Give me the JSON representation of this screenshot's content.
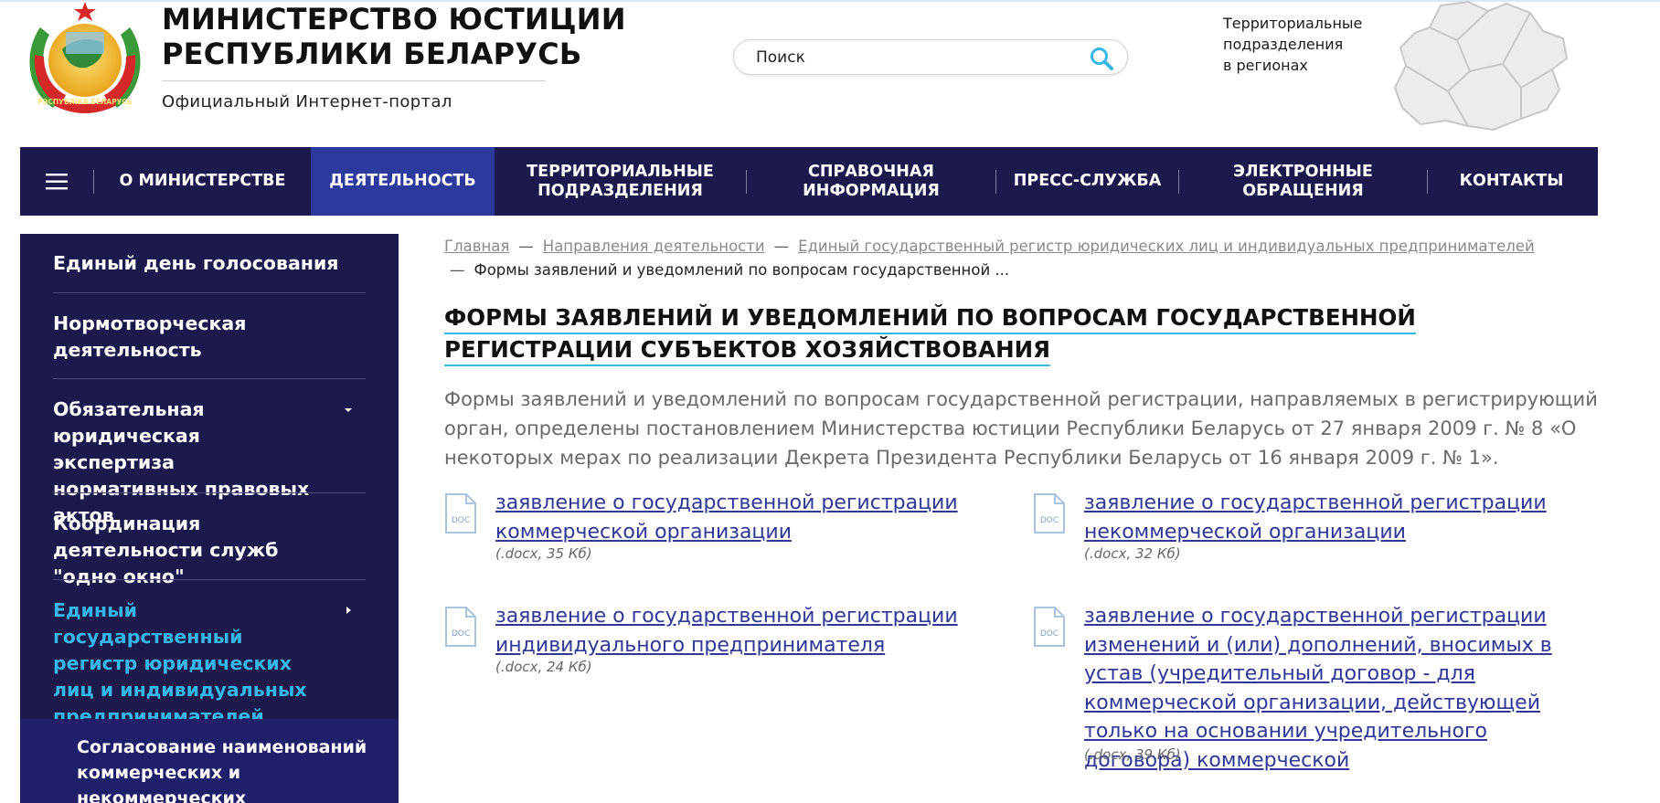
{
  "header": {
    "title_line1": "МИНИСТЕРСТВО ЮСТИЦИИ",
    "title_line2": "РЕСПУБЛИКИ БЕЛАРУСЬ",
    "subtitle": "Официальный Интернет-портал",
    "emblem_ribbon_text": "РЭСПУБЛІКА БЕЛАРУСЬ",
    "search": {
      "placeholder": "Поиск"
    },
    "regions": {
      "line1": "Территориальные",
      "line2": "подразделения",
      "line3": "в регионах"
    }
  },
  "nav": {
    "items": [
      {
        "line1": "О МИНИСТЕРСТВЕ",
        "line2": ""
      },
      {
        "line1": "ДЕЯТЕЛЬНОСТЬ",
        "line2": ""
      },
      {
        "line1": "ТЕРРИТОРИАЛЬНЫЕ",
        "line2": "ПОДРАЗДЕЛЕНИЯ"
      },
      {
        "line1": "СПРАВОЧНАЯ",
        "line2": "ИНФОРМАЦИЯ"
      },
      {
        "line1": "ПРЕСС-СЛУЖБА",
        "line2": ""
      },
      {
        "line1": "ЭЛЕКТРОННЫЕ",
        "line2": "ОБРАЩЕНИЯ"
      },
      {
        "line1": "КОНТАКТЫ",
        "line2": ""
      }
    ],
    "active_index": 1
  },
  "sidebar": {
    "items": [
      {
        "label": "Единый день голосования"
      },
      {
        "label": "Нормотворческая деятельность"
      },
      {
        "label": "Обязательная юридическая экспертиза нормативных правовых актов"
      },
      {
        "label": "Координация деятельности служб \"одно окно\""
      },
      {
        "label": "Единый государственный регистр юридических лиц и индивидуальных предпринимателей"
      }
    ],
    "sub_items": [
      {
        "label": "Согласование наименований коммерческих и некоммерческих"
      }
    ],
    "active_color": "#35b6e6",
    "background": "#1c1a4d"
  },
  "breadcrumb": {
    "items": [
      "Главная",
      "Направления деятельности",
      "Единый государственный регистр юридических лиц и индивидуальных предпринимателей"
    ],
    "current": "Формы заявлений и уведомлений по вопросам государственной ..."
  },
  "content": {
    "title": "ФОРМЫ ЗАЯВЛЕНИЙ И УВЕДОМЛЕНИЙ ПО ВОПРОСАМ ГОСУДАРСТВЕННОЙ РЕГИСТРАЦИИ СУБЪЕКТОВ ХОЗЯЙСТВОВАНИЯ",
    "intro": "Формы заявлений и уведомлений по вопросам государственной регистрации, направляемых в регистрирующий орган, определены постановлением Министерства юстиции Республики Беларусь от 27 января 2009 г. № 8 «О некоторых мерах по реализации Декрета Президента Республики Беларусь от 16 января 2009 г. № 1».",
    "files": [
      {
        "title": "заявление о государственной регистрации коммерческой организации",
        "meta": "(.docx, 35 Кб)",
        "icon_label": "DOC"
      },
      {
        "title": "заявление о государственной регистрации некоммерческой организации",
        "meta": "(.docx, 32 Кб)",
        "icon_label": "DOC"
      },
      {
        "title": "заявление о государственной регистрации индивидуального предпринимателя",
        "meta": "(.docx, 24 Кб)",
        "icon_label": "DOC"
      },
      {
        "title": "заявление о государственной регистрации изменений и (или) дополнений, вносимых в устав (учредительный договор - для коммерческой организации, действующей только на основании учредительного договора) коммерческой",
        "meta": "(.docx, 39 Кб)",
        "icon_label": "DOC"
      }
    ]
  },
  "colors": {
    "nav_bg": "#1c1a4d",
    "nav_active": "#2d3a9d",
    "accent": "#35b6e6",
    "link": "#2f3797"
  }
}
